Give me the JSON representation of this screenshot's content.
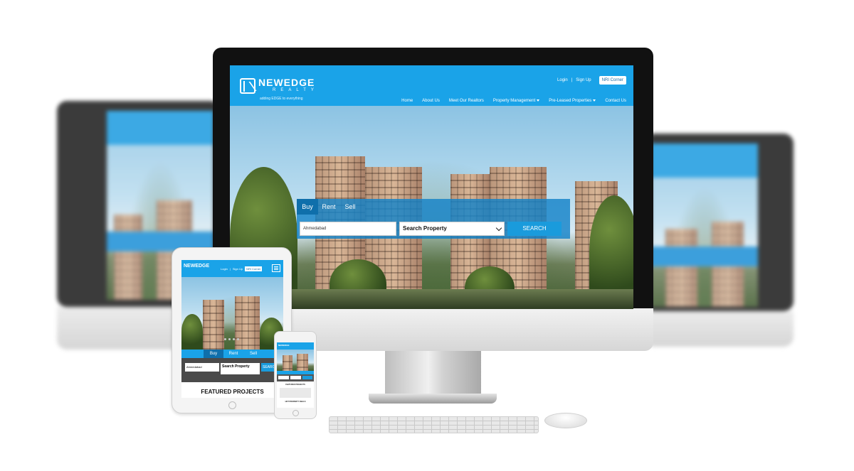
{
  "brand": {
    "name": "NEWEDGE",
    "sub": "REALTY",
    "tagline": "adding EDGE to everything"
  },
  "desktop": {
    "top_links": {
      "login": "Login",
      "separator": "|",
      "signup": "Sign Up",
      "nri": "NRI Corner"
    },
    "nav": [
      {
        "label": "Home"
      },
      {
        "label": "About Us"
      },
      {
        "label": "Meet Our Realtors"
      },
      {
        "label": "Property Management",
        "dropdown": true
      },
      {
        "label": "Pre-Leased Properties",
        "dropdown": true
      },
      {
        "label": "Contact Us"
      }
    ],
    "search": {
      "tabs": [
        "Buy",
        "Rent",
        "Sell"
      ],
      "active_tab": "Buy",
      "city_value": "Ahmedabad",
      "type_value": "Search Property",
      "button": "SEARCH"
    }
  },
  "tablet": {
    "logo": "NEWEDGE",
    "top_links": {
      "login": "Login",
      "separator": "|",
      "signup": "Sign Up",
      "nri": "NRI Corner"
    },
    "tabs": [
      "Buy",
      "Rent",
      "Sell"
    ],
    "city_value": "Ahmedabad",
    "type_value": "Search Property",
    "button": "SEARCH",
    "featured_title": "FEATURED PROJECTS"
  },
  "phone": {
    "logo": "NEWEDGE",
    "featured_title": "FEATURED PROJECTS",
    "hot_deals_title": "HOT PROPERTY DEALS"
  },
  "colors": {
    "brand_blue": "#1aa3e8",
    "tab_active": "#0f6fab",
    "button_blue": "#1a9bdc"
  }
}
